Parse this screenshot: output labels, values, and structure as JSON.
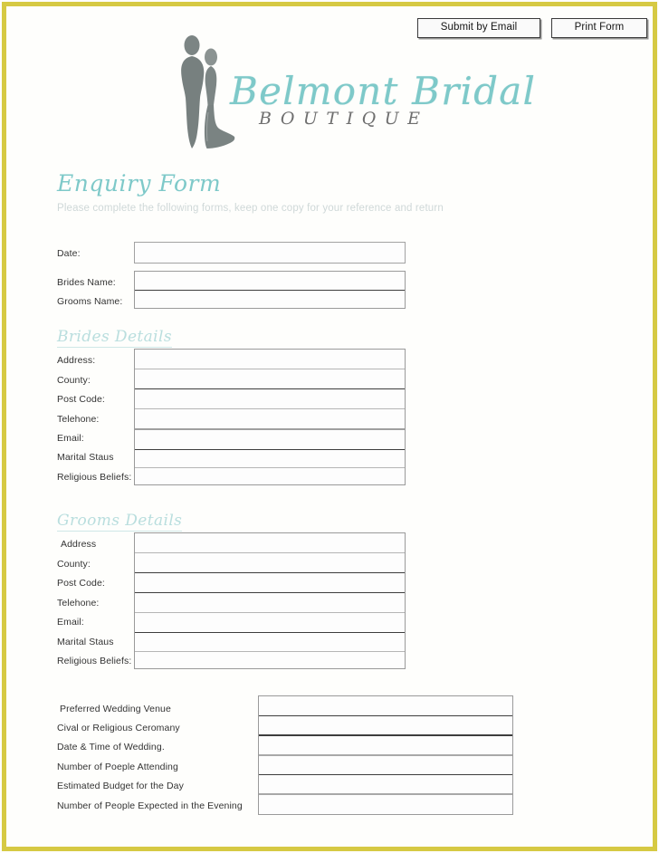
{
  "document": {
    "title": "Belmont Bridal Boutique Enquiry Form",
    "frame_color": "#d6c943",
    "accent_teal": "#7ec9c9",
    "page_background": "#fefefc"
  },
  "toolbar": {
    "submit_label": "Submit by Email",
    "print_label": "Print Form"
  },
  "logo": {
    "script_text": "Belmont Bridal",
    "sub_text": "BOUTIQUE",
    "mark_name": "bride-and-groom-silhouette",
    "script_color": "#7ec9c9",
    "sub_color": "#6f6f6f",
    "mark_color": "#77807f"
  },
  "form": {
    "title": "Enquiry Form",
    "subtitle": "Please complete the following forms, keep one copy for your reference and return",
    "top_fields": [
      {
        "label": "Date:",
        "value": ""
      },
      {
        "label": "Brides Name:",
        "value": ""
      },
      {
        "label": "Grooms Name:",
        "value": ""
      }
    ],
    "brides": {
      "heading": "Brides Details",
      "fields": [
        {
          "label": "Address:",
          "value": ""
        },
        {
          "label": "County:",
          "value": ""
        },
        {
          "label": "Post Code:",
          "value": ""
        },
        {
          "label": "Telehone:",
          "value": ""
        },
        {
          "label": "Email:",
          "value": ""
        },
        {
          "label": "Marital Staus",
          "value": ""
        },
        {
          "label": "Religious Beliefs:",
          "value": ""
        }
      ]
    },
    "grooms": {
      "heading": "Grooms Details",
      "fields": [
        {
          "label": "Address",
          "value": ""
        },
        {
          "label": "County:",
          "value": ""
        },
        {
          "label": "Post Code:",
          "value": ""
        },
        {
          "label": "Telehone:",
          "value": ""
        },
        {
          "label": "Email:",
          "value": ""
        },
        {
          "label": "Marital Staus",
          "value": ""
        },
        {
          "label": "Religious Beliefs:",
          "value": ""
        }
      ]
    },
    "wedding": {
      "fields": [
        {
          "label": "Preferred Wedding Venue",
          "value": ""
        },
        {
          "label": "Cival or Religious Ceromany",
          "value": ""
        },
        {
          "label": "Date & Time of Wedding.",
          "value": ""
        },
        {
          "label": "Number of Poeple Attending",
          "value": ""
        },
        {
          "label": "Estimated Budget for the  Day",
          "value": ""
        },
        {
          "label": "Number of People Expected in the Evening",
          "value": ""
        }
      ]
    }
  }
}
